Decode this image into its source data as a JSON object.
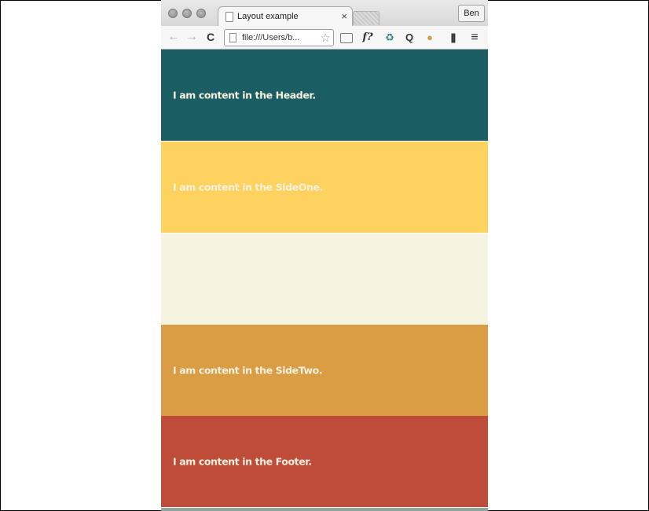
{
  "browser": {
    "tab_title": "Layout example",
    "tab_close": "×",
    "profile_name": "Ben",
    "url": "file:///Users/b...",
    "star": "☆",
    "back": "←",
    "forward": "→",
    "reload": "C",
    "extensions": [
      "f?",
      "♻",
      "Q",
      "●",
      "|||",
      "≡"
    ]
  },
  "sections": {
    "header": "I am content in the Header.",
    "sideone": "I am content in the SideOne.",
    "main": "",
    "sidetwo": "I am content in the SideTwo.",
    "footer": "I am content in the Footer."
  },
  "colors": {
    "header": "#1a5e63",
    "sideone": "#fdd25f",
    "main": "#f6f3e0",
    "sidetwo": "#db9d43",
    "footer": "#bf4c39"
  }
}
